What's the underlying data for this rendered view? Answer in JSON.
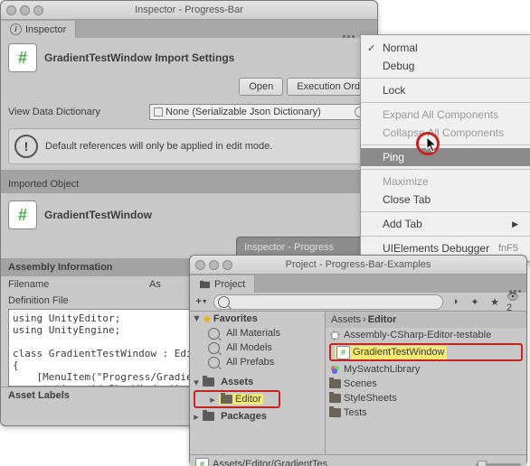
{
  "inspector": {
    "window_title": "Inspector - Progress-Bar",
    "tab_label": "Inspector",
    "header_title": "GradientTestWindow Import Settings",
    "buttons": {
      "open": "Open",
      "exec_order": "Execution Ord"
    },
    "view_dict_label": "View Data Dictionary",
    "view_dict_value": "None (Serializable Json Dictionary)",
    "warn_text": "Default references will only be applied in edit mode.",
    "imported_label": "Imported Object",
    "imported_name": "GradientTestWindow",
    "footer_title": "Inspector - Progress",
    "assembly_info": "Assembly Information",
    "filename_label": "Filename",
    "filename_value": "As",
    "def_file_label": "Definition File",
    "code": "using UnityEditor;\nusing UnityEngine;\n\nclass GradientTestWindow : EditorW\n{\n    [MenuItem(\"Progress/GradientTe\n    static void ShowWindow()",
    "asset_labels": "Asset Labels"
  },
  "context_menu": {
    "normal": "Normal",
    "debug": "Debug",
    "lock": "Lock",
    "expand": "Expand All Components",
    "collapse": "Collapse All Components",
    "ping": "Ping",
    "maximize": "Maximize",
    "close": "Close Tab",
    "add_tab": "Add Tab",
    "debugger": "UIElements Debugger",
    "shortcut": "fnF5"
  },
  "project": {
    "window_title": "Project - Progress-Bar-Examples",
    "tab_label": "Project",
    "crumb_root": "Assets",
    "crumb_sep": "›",
    "crumb_leaf": "Editor",
    "favorites_label": "Favorites",
    "fav_items": [
      "All Materials",
      "All Models",
      "All Prefabs"
    ],
    "tree": {
      "assets": "Assets",
      "editor": "Editor",
      "packages": "Packages"
    },
    "right_items": {
      "asm": "Assembly-CSharp-Editor-testable",
      "gtw": "GradientTestWindow",
      "swatch": "MySwatchLibrary",
      "scenes": "Scenes",
      "styles": "StyleSheets",
      "tests": "Tests"
    },
    "footer_path": "Assets/Editor/GradientTes",
    "search_placeholder": ""
  }
}
